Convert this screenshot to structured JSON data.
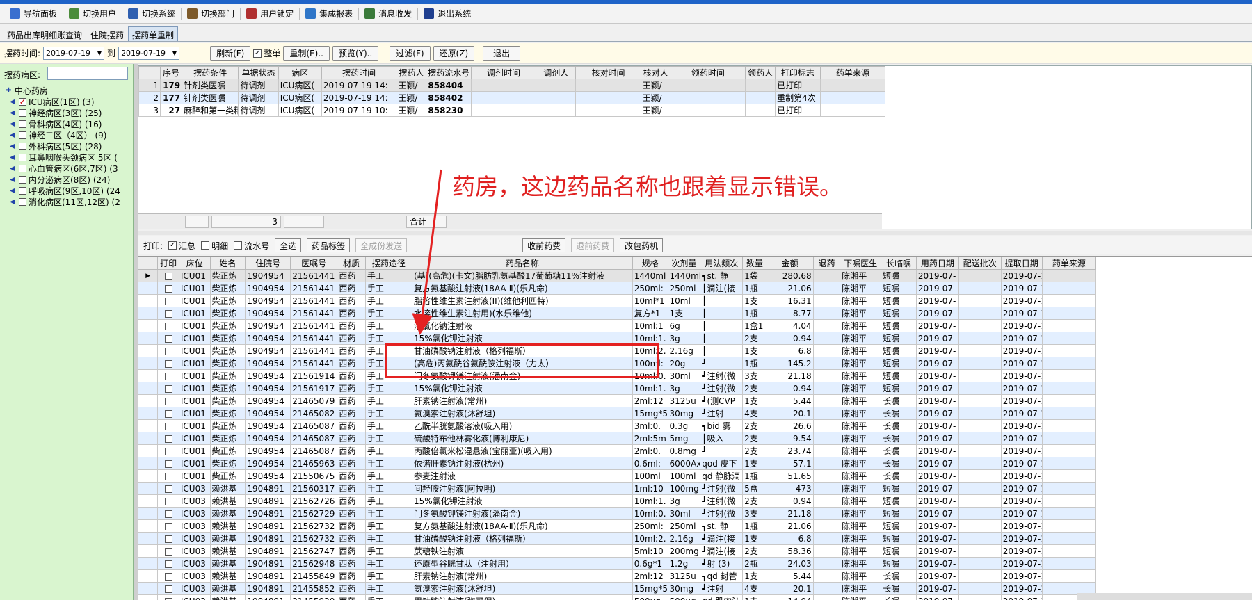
{
  "toolbar": [
    {
      "label": "导航面板",
      "icon": "navigation-panel-icon",
      "color": "#3a6fcf"
    },
    {
      "label": "切换用户",
      "icon": "switch-user-icon",
      "color": "#4c8c3c"
    },
    {
      "label": "切换系统",
      "icon": "switch-system-icon",
      "color": "#2f5fb0"
    },
    {
      "label": "切换部门",
      "icon": "switch-department-icon",
      "color": "#7d5a2a"
    },
    {
      "label": "用户锁定",
      "icon": "user-lock-icon",
      "color": "#b03030"
    },
    {
      "label": "集成报表",
      "icon": "report-icon",
      "color": "#2f76c8"
    },
    {
      "label": "消息收发",
      "icon": "message-icon",
      "color": "#3a7a3a"
    },
    {
      "label": "退出系统",
      "icon": "exit-icon",
      "color": "#1f3f8f"
    }
  ],
  "tabs": [
    {
      "label": "药品出库明细账查询",
      "active": false
    },
    {
      "label": "住院摆药",
      "active": false
    },
    {
      "label": "摆药单重制",
      "active": true
    }
  ],
  "filter": {
    "time_label": "摆药时间:",
    "date_from": "2019-07-19",
    "to_label": "到",
    "date_to": "2019-07-19",
    "refresh": "刷新(F)",
    "whole_label": "整单",
    "redo": "重制(E)..",
    "preview": "预览(Y)..",
    "filter": "过滤(F)",
    "restore": "还原(Z)",
    "exit": "退出"
  },
  "ward": {
    "label": "摆药病区:",
    "tree": [
      {
        "label": "中心药房",
        "root": true,
        "checked": false
      },
      {
        "label": "ICU病区(1区)  (3)",
        "root": false,
        "checked": true
      },
      {
        "label": "神经病区(3区)  (25)",
        "root": false,
        "checked": false
      },
      {
        "label": "骨科病区(4区)  (16)",
        "root": false,
        "checked": false
      },
      {
        "label": "神经二区（4区）  (9)",
        "root": false,
        "checked": false
      },
      {
        "label": "外科病区(5区)  (28)",
        "root": false,
        "checked": false
      },
      {
        "label": "耳鼻咽喉头颈病区 5区 (",
        "root": false,
        "checked": false
      },
      {
        "label": "心血管病区(6区,7区) (3",
        "root": false,
        "checked": false
      },
      {
        "label": "内分泌病区(8区)  (24)",
        "root": false,
        "checked": false
      },
      {
        "label": "呼吸病区(9区,10区)  (24",
        "root": false,
        "checked": false
      },
      {
        "label": "消化病区(11区,12区)  (2",
        "root": false,
        "checked": false
      }
    ]
  },
  "upper": {
    "headers": [
      "序号",
      "摆药条件",
      "单据状态",
      "病区",
      "摆药时间",
      "摆药人",
      "摆药流水号",
      "调剂时间",
      "调剂人",
      "核对时间",
      "核对人",
      "领药时间",
      "领药人",
      "打印标志",
      "药单来源"
    ],
    "rows": [
      [
        "1",
        "179",
        "针剂类医嘱",
        "待调剂",
        "ICU病区(",
        "2019-07-19 14:",
        "王颖/",
        "858404",
        "",
        "",
        "",
        "王颖/",
        "",
        "",
        "已打印",
        ""
      ],
      [
        "2",
        "177",
        "针剂类医嘱",
        "待调剂",
        "ICU病区(",
        "2019-07-19 14:",
        "王颖/",
        "858402",
        "",
        "",
        "",
        "王颖/",
        "",
        "",
        "重制第4次",
        ""
      ],
      [
        "3",
        "27",
        "麻醉和第一类精神",
        "待调剂",
        "ICU病区(",
        "2019-07-19 10:",
        "王颖/",
        "858230",
        "",
        "",
        "",
        "王颖/",
        "",
        "",
        "已打印",
        ""
      ]
    ],
    "footer_count": "3",
    "footer_total": "合计"
  },
  "printbar": {
    "label": "打印:",
    "summary": "汇总",
    "detail": "明细",
    "serial": "流水号",
    "select_all": "全选",
    "drug_label": "药品标签",
    "all_send": "全成份发送",
    "receive": "收前药费",
    "refund": "退前药费",
    "repack": "改包药机"
  },
  "lower": {
    "headers": [
      "打印",
      "床位",
      "姓名",
      "住院号",
      "医嘱号",
      "材质",
      "摆药途径",
      "药品名称",
      "规格",
      "次剂量",
      "用法频次",
      "数量",
      "金额",
      "退药",
      "下嘱医生",
      "长临嘱",
      "用药日期",
      "配送批次",
      "提取日期",
      "药单来源"
    ],
    "rows": [
      [
        "ICU01",
        "柴正炼",
        "1904954",
        "21561441",
        "西药",
        "手工",
        "(基)(高危)(卡文)脂肪乳氨基酸17葡萄糖11%注射液",
        "1440ml",
        "1440ml",
        "┓st. 静",
        "1袋",
        "280.68",
        "",
        "陈湘平",
        "短嘱",
        "2019-07-",
        "",
        "2019-07-1",
        ""
      ],
      [
        "ICU01",
        "柴正炼",
        "1904954",
        "21561441",
        "西药",
        "手工",
        "复方氨基酸注射液(18AA-Ⅱ)(乐凡命)",
        "250ml:",
        "250ml",
        "┃滴注(接",
        "1瓶",
        "21.06",
        "",
        "陈湘平",
        "短嘱",
        "2019-07-",
        "",
        "2019-07-1",
        ""
      ],
      [
        "ICU01",
        "柴正炼",
        "1904954",
        "21561441",
        "西药",
        "手工",
        "脂溶性维生素注射液(II)(维他利匹特)",
        "10ml*1",
        "10ml",
        "┃",
        "1支",
        "16.31",
        "",
        "陈湘平",
        "短嘱",
        "2019-07-",
        "",
        "2019-07-1",
        ""
      ],
      [
        "ICU01",
        "柴正炼",
        "1904954",
        "21561441",
        "西药",
        "手工",
        "水溶性维生素注射用)(水乐维他)",
        "复方*1",
        "1支",
        "┃",
        "1瓶",
        "8.77",
        "",
        "陈湘平",
        "短嘱",
        "2019-07-",
        "",
        "2019-07-1",
        ""
      ],
      [
        "ICU01",
        "柴正炼",
        "1904954",
        "21561441",
        "西药",
        "手工",
        "浓氯化钠注射液",
        "10ml:1",
        "6g",
        "┃",
        "1盒1",
        "4.04",
        "",
        "陈湘平",
        "短嘱",
        "2019-07-",
        "",
        "2019-07-1",
        ""
      ],
      [
        "ICU01",
        "柴正炼",
        "1904954",
        "21561441",
        "西药",
        "手工",
        "15%氯化钾注射液",
        "10ml:1.",
        "3g",
        "┃",
        "2支",
        "0.94",
        "",
        "陈湘平",
        "短嘱",
        "2019-07-",
        "",
        "2019-07-1",
        ""
      ],
      [
        "ICU01",
        "柴正炼",
        "1904954",
        "21561441",
        "西药",
        "手工",
        "甘油磷酸钠注射液（格列福斯）",
        "10ml:2.",
        "2.16g",
        "┃",
        "1支",
        "6.8",
        "",
        "陈湘平",
        "短嘱",
        "2019-07-",
        "",
        "2019-07-1",
        ""
      ],
      [
        "ICU01",
        "柴正炼",
        "1904954",
        "21561441",
        "西药",
        "手工",
        "(高危)丙氨酰谷氨酰胺注射液（力太）",
        "100ml:",
        "20g",
        "┛",
        "1瓶",
        "145.2",
        "",
        "陈湘平",
        "短嘱",
        "2019-07-",
        "",
        "2019-07-1",
        ""
      ],
      [
        "ICU01",
        "柴正炼",
        "1904954",
        "21561914",
        "西药",
        "手工",
        "门冬氨酸钾镁注射液(潘南金)",
        "10ml:0.",
        "30ml",
        "┛注射(微",
        "3支",
        "21.18",
        "",
        "陈湘平",
        "短嘱",
        "2019-07-",
        "",
        "2019-07-1",
        ""
      ],
      [
        "ICU01",
        "柴正炼",
        "1904954",
        "21561917",
        "西药",
        "手工",
        "15%氯化钾注射液",
        "10ml:1.",
        "3g",
        "┛注射(微",
        "2支",
        "0.94",
        "",
        "陈湘平",
        "短嘱",
        "2019-07-",
        "",
        "2019-07-1",
        ""
      ],
      [
        "ICU01",
        "柴正炼",
        "1904954",
        "21465079",
        "西药",
        "手工",
        "肝素钠注射液(常州)",
        "2ml:12",
        "3125u",
        "┛(测CVP",
        "1支",
        "5.44",
        "",
        "陈湘平",
        "长嘱",
        "2019-07-",
        "",
        "2019-07-1",
        ""
      ],
      [
        "ICU01",
        "柴正炼",
        "1904954",
        "21465082",
        "西药",
        "手工",
        "氨溴索注射液(沐舒坦)",
        "15mg*5",
        "30mg",
        "┛注射",
        "4支",
        "20.1",
        "",
        "陈湘平",
        "长嘱",
        "2019-07-",
        "",
        "2019-07-1",
        ""
      ],
      [
        "ICU01",
        "柴正炼",
        "1904954",
        "21465087",
        "西药",
        "手工",
        "乙酰半胱氨酸溶液(吸入用)",
        "3ml:0.",
        "0.3g",
        "┓bid 雾",
        "2支",
        "26.6",
        "",
        "陈湘平",
        "长嘱",
        "2019-07-",
        "",
        "2019-07-1",
        ""
      ],
      [
        "ICU01",
        "柴正炼",
        "1904954",
        "21465087",
        "西药",
        "手工",
        "硫酸特布他林雾化液(博利康尼)",
        "2ml:5m",
        "5mg",
        "┃吸入",
        "2支",
        "9.54",
        "",
        "陈湘平",
        "长嘱",
        "2019-07-",
        "",
        "2019-07-1",
        ""
      ],
      [
        "ICU01",
        "柴正炼",
        "1904954",
        "21465087",
        "西药",
        "手工",
        "丙酸倍氯米松混悬液(宝丽亚)(吸入用)",
        "2ml:0.",
        "0.8mg",
        "┛",
        "2支",
        "23.74",
        "",
        "陈湘平",
        "长嘱",
        "2019-07-",
        "",
        "2019-07-1",
        ""
      ],
      [
        "ICU01",
        "柴正炼",
        "1904954",
        "21465963",
        "西药",
        "手工",
        "依诺肝素钠注射液(杭州)",
        "0.6ml:",
        "6000Ax",
        "qod 皮下",
        "1支",
        "57.1",
        "",
        "陈湘平",
        "长嘱",
        "2019-07-",
        "",
        "2019-07-1",
        ""
      ],
      [
        "ICU01",
        "柴正炼",
        "1904954",
        "21550675",
        "西药",
        "手工",
        "参麦注射液",
        "100ml",
        "100ml",
        "qd 静脉滴",
        "1瓶",
        "51.65",
        "",
        "陈湘平",
        "长嘱",
        "2019-07-",
        "",
        "2019-07-1",
        ""
      ],
      [
        "ICU03",
        "赖洪基",
        "1904891",
        "21560317",
        "西药",
        "手工",
        "间羟胺注射液(阿拉明)",
        "1ml:10",
        "100mg",
        "┛注射(微",
        "5盒",
        "473",
        "",
        "陈湘平",
        "短嘱",
        "2019-07-",
        "",
        "2019-07-1",
        ""
      ],
      [
        "ICU03",
        "赖洪基",
        "1904891",
        "21562726",
        "西药",
        "手工",
        "15%氯化钾注射液",
        "10ml:1.",
        "3g",
        "┛注射(微",
        "2支",
        "0.94",
        "",
        "陈湘平",
        "短嘱",
        "2019-07-",
        "",
        "2019-07-1",
        ""
      ],
      [
        "ICU03",
        "赖洪基",
        "1904891",
        "21562729",
        "西药",
        "手工",
        "门冬氨酸钾镁注射液(潘南金)",
        "10ml:0.",
        "30ml",
        "┛注射(微",
        "3支",
        "21.18",
        "",
        "陈湘平",
        "短嘱",
        "2019-07-",
        "",
        "2019-07-1",
        ""
      ],
      [
        "ICU03",
        "赖洪基",
        "1904891",
        "21562732",
        "西药",
        "手工",
        "复方氨基酸注射液(18AA-Ⅱ)(乐凡命)",
        "250ml:",
        "250ml",
        "┓st. 静",
        "1瓶",
        "21.06",
        "",
        "陈湘平",
        "短嘱",
        "2019-07-",
        "",
        "2019-07-1",
        ""
      ],
      [
        "ICU03",
        "赖洪基",
        "1904891",
        "21562732",
        "西药",
        "手工",
        "甘油磷酸钠注射液（格列福斯）",
        "10ml:2.",
        "2.16g",
        "┛滴注(接",
        "1支",
        "6.8",
        "",
        "陈湘平",
        "短嘱",
        "2019-07-",
        "",
        "2019-07-1",
        ""
      ],
      [
        "ICU03",
        "赖洪基",
        "1904891",
        "21562747",
        "西药",
        "手工",
        "蔗糖铁注射液",
        "5ml:10",
        "200mg",
        "┛滴注(接",
        "2支",
        "58.36",
        "",
        "陈湘平",
        "短嘱",
        "2019-07-",
        "",
        "2019-07-1",
        ""
      ],
      [
        "ICU03",
        "赖洪基",
        "1904891",
        "21562948",
        "西药",
        "手工",
        "还原型谷胱甘肽（注射用）",
        "0.6g*1",
        "1.2g",
        "┛射 (3)",
        "2瓶",
        "24.03",
        "",
        "陈湘平",
        "短嘱",
        "2019-07-",
        "",
        "2019-07-1",
        ""
      ],
      [
        "ICU03",
        "赖洪基",
        "1904891",
        "21455849",
        "西药",
        "手工",
        "肝素钠注射液(常州)",
        "2ml:12",
        "3125u",
        "┓qd 封管",
        "1支",
        "5.44",
        "",
        "陈湘平",
        "长嘱",
        "2019-07-",
        "",
        "2019-07-1",
        ""
      ],
      [
        "ICU03",
        "赖洪基",
        "1904891",
        "21455852",
        "西药",
        "手工",
        "氨溴索注射液(沐舒坦)",
        "15mg*5",
        "30mg",
        "┛注射",
        "4支",
        "20.1",
        "",
        "陈湘平",
        "长嘱",
        "2019-07-",
        "",
        "2019-07-1",
        ""
      ],
      [
        "ICU03",
        "赖洪基",
        "1904891",
        "21455920",
        "西药",
        "手工",
        "甲钴胺注射液(弥可保)",
        "500ug",
        "500ug",
        "qd 肌肉注",
        "1支",
        "14.04",
        "",
        "陈湘平",
        "长嘱",
        "2019-07-",
        "",
        "2019-07-1",
        ""
      ]
    ]
  },
  "annotation": {
    "text": "药房，这边药品名称也跟着显示错误。",
    "color": "#e02020"
  }
}
